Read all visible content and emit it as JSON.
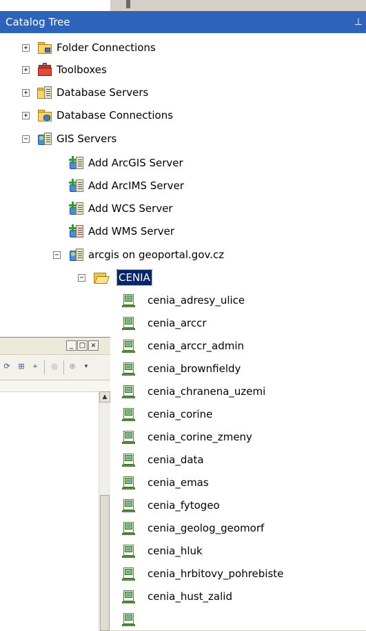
{
  "catalog_tree": {
    "title": "Catalog Tree",
    "pin_icon": "pin-icon",
    "top_nodes": [
      {
        "label": "Folder Connections",
        "expander": "+",
        "icon": "folder-connection-icon"
      },
      {
        "label": "Toolboxes",
        "expander": "+",
        "icon": "toolbox-icon"
      },
      {
        "label": "Database Servers",
        "expander": "+",
        "icon": "database-server-icon"
      },
      {
        "label": "Database Connections",
        "expander": "+",
        "icon": "database-connection-icon"
      },
      {
        "label": "GIS Servers",
        "expander": "−",
        "icon": "gis-server-icon"
      }
    ],
    "gis_children": [
      {
        "label": "Add ArcGIS Server",
        "icon": "add-server-icon"
      },
      {
        "label": "Add ArcIMS Server",
        "icon": "add-server-icon"
      },
      {
        "label": "Add WCS Server",
        "icon": "add-server-icon"
      },
      {
        "label": "Add WMS Server",
        "icon": "add-server-icon"
      }
    ],
    "server": {
      "label": "arcgis on geoportal.gov.cz",
      "expander": "−",
      "icon": "gis-server-icon"
    },
    "folder": {
      "label": "CENIA",
      "expander": "−",
      "icon": "open-folder-icon",
      "selected": true
    },
    "services": [
      "cenia_adresy_ulice",
      "cenia_arccr",
      "cenia_arccr_admin",
      "cenia_brownfieldy",
      "cenia_chranena_uzemi",
      "cenia_corine",
      "cenia_corine_zmeny",
      "cenia_data",
      "cenia_emas",
      "cenia_fytogeo",
      "cenia_geolog_geomorf",
      "cenia_hluk",
      "cenia_hrbitovy_pohrebiste",
      "cenia_hust_zalid"
    ]
  },
  "background_window": {
    "buttons": {
      "minimize": "_",
      "maximize": "□",
      "close": "×"
    },
    "toolbar_icons": [
      "refresh-icon",
      "add-xy-icon",
      "disabled-tool-icon",
      "zoom-icon"
    ],
    "scroll_up": "▲"
  },
  "colors": {
    "header_bg": "#2d63b8",
    "selection_bg": "#0a246a",
    "panel_bg": "#ffffff"
  }
}
